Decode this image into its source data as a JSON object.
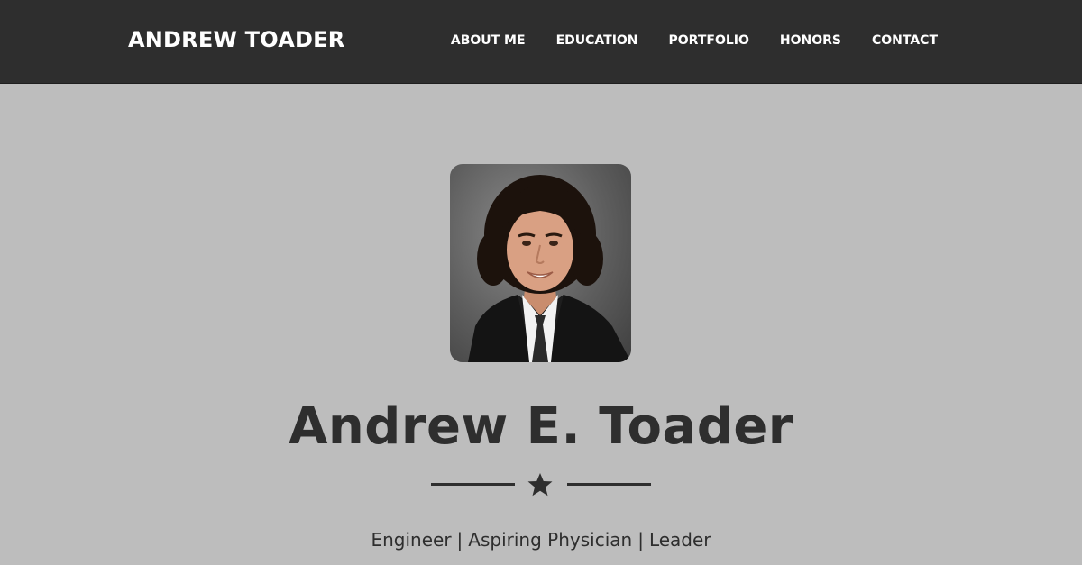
{
  "header": {
    "brand": "ANDREW TOADER",
    "nav": [
      {
        "label": "ABOUT ME"
      },
      {
        "label": "EDUCATION"
      },
      {
        "label": "PORTFOLIO"
      },
      {
        "label": "HONORS"
      },
      {
        "label": "CONTACT"
      }
    ]
  },
  "hero": {
    "photo_icon": "profile-photo",
    "name": "Andrew E. Toader",
    "divider_icon": "star-icon",
    "tagline": {
      "items": [
        "Engineer",
        "Aspiring Physician",
        "Leader"
      ],
      "separator": "|"
    }
  },
  "colors": {
    "navbar": "#2e2e2e",
    "background": "#bdbdbd",
    "text": "#2e2e2e",
    "nav_text": "#ffffff"
  }
}
